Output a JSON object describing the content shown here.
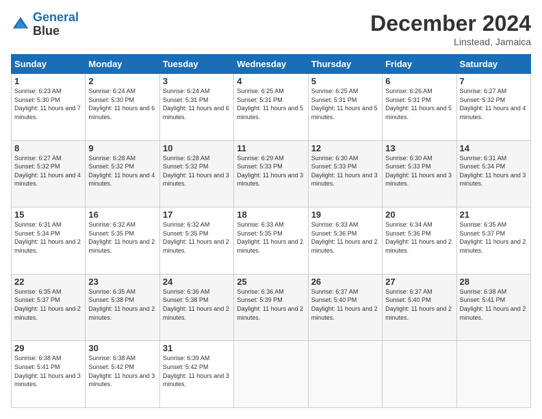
{
  "logo": {
    "line1": "General",
    "line2": "Blue"
  },
  "title": "December 2024",
  "subtitle": "Linstead, Jamaica",
  "days_header": [
    "Sunday",
    "Monday",
    "Tuesday",
    "Wednesday",
    "Thursday",
    "Friday",
    "Saturday"
  ],
  "weeks": [
    [
      {
        "day": "1",
        "sunrise": "6:23 AM",
        "sunset": "5:30 PM",
        "daylight": "11 hours and 7 minutes."
      },
      {
        "day": "2",
        "sunrise": "6:24 AM",
        "sunset": "5:30 PM",
        "daylight": "11 hours and 6 minutes."
      },
      {
        "day": "3",
        "sunrise": "6:24 AM",
        "sunset": "5:31 PM",
        "daylight": "11 hours and 6 minutes."
      },
      {
        "day": "4",
        "sunrise": "6:25 AM",
        "sunset": "5:31 PM",
        "daylight": "11 hours and 5 minutes."
      },
      {
        "day": "5",
        "sunrise": "6:25 AM",
        "sunset": "5:31 PM",
        "daylight": "11 hours and 5 minutes."
      },
      {
        "day": "6",
        "sunrise": "6:26 AM",
        "sunset": "5:31 PM",
        "daylight": "11 hours and 5 minutes."
      },
      {
        "day": "7",
        "sunrise": "6:27 AM",
        "sunset": "5:32 PM",
        "daylight": "11 hours and 4 minutes."
      }
    ],
    [
      {
        "day": "8",
        "sunrise": "6:27 AM",
        "sunset": "5:32 PM",
        "daylight": "11 hours and 4 minutes."
      },
      {
        "day": "9",
        "sunrise": "6:28 AM",
        "sunset": "5:32 PM",
        "daylight": "11 hours and 4 minutes."
      },
      {
        "day": "10",
        "sunrise": "6:28 AM",
        "sunset": "5:32 PM",
        "daylight": "11 hours and 3 minutes."
      },
      {
        "day": "11",
        "sunrise": "6:29 AM",
        "sunset": "5:33 PM",
        "daylight": "11 hours and 3 minutes."
      },
      {
        "day": "12",
        "sunrise": "6:30 AM",
        "sunset": "5:33 PM",
        "daylight": "11 hours and 3 minutes."
      },
      {
        "day": "13",
        "sunrise": "6:30 AM",
        "sunset": "5:33 PM",
        "daylight": "11 hours and 3 minutes."
      },
      {
        "day": "14",
        "sunrise": "6:31 AM",
        "sunset": "5:34 PM",
        "daylight": "11 hours and 3 minutes."
      }
    ],
    [
      {
        "day": "15",
        "sunrise": "6:31 AM",
        "sunset": "5:34 PM",
        "daylight": "11 hours and 2 minutes."
      },
      {
        "day": "16",
        "sunrise": "6:32 AM",
        "sunset": "5:35 PM",
        "daylight": "11 hours and 2 minutes."
      },
      {
        "day": "17",
        "sunrise": "6:32 AM",
        "sunset": "5:35 PM",
        "daylight": "11 hours and 2 minutes."
      },
      {
        "day": "18",
        "sunrise": "6:33 AM",
        "sunset": "5:35 PM",
        "daylight": "11 hours and 2 minutes."
      },
      {
        "day": "19",
        "sunrise": "6:33 AM",
        "sunset": "5:36 PM",
        "daylight": "11 hours and 2 minutes."
      },
      {
        "day": "20",
        "sunrise": "6:34 AM",
        "sunset": "5:36 PM",
        "daylight": "11 hours and 2 minutes."
      },
      {
        "day": "21",
        "sunrise": "6:35 AM",
        "sunset": "5:37 PM",
        "daylight": "11 hours and 2 minutes."
      }
    ],
    [
      {
        "day": "22",
        "sunrise": "6:35 AM",
        "sunset": "5:37 PM",
        "daylight": "11 hours and 2 minutes."
      },
      {
        "day": "23",
        "sunrise": "6:35 AM",
        "sunset": "5:38 PM",
        "daylight": "11 hours and 2 minutes."
      },
      {
        "day": "24",
        "sunrise": "6:36 AM",
        "sunset": "5:38 PM",
        "daylight": "11 hours and 2 minutes."
      },
      {
        "day": "25",
        "sunrise": "6:36 AM",
        "sunset": "5:39 PM",
        "daylight": "11 hours and 2 minutes."
      },
      {
        "day": "26",
        "sunrise": "6:37 AM",
        "sunset": "5:40 PM",
        "daylight": "11 hours and 2 minutes."
      },
      {
        "day": "27",
        "sunrise": "6:37 AM",
        "sunset": "5:40 PM",
        "daylight": "11 hours and 2 minutes."
      },
      {
        "day": "28",
        "sunrise": "6:38 AM",
        "sunset": "5:41 PM",
        "daylight": "11 hours and 2 minutes."
      }
    ],
    [
      {
        "day": "29",
        "sunrise": "6:38 AM",
        "sunset": "5:41 PM",
        "daylight": "11 hours and 3 minutes."
      },
      {
        "day": "30",
        "sunrise": "6:38 AM",
        "sunset": "5:42 PM",
        "daylight": "11 hours and 3 minutes."
      },
      {
        "day": "31",
        "sunrise": "6:39 AM",
        "sunset": "5:42 PM",
        "daylight": "11 hours and 3 minutes."
      },
      null,
      null,
      null,
      null
    ]
  ]
}
